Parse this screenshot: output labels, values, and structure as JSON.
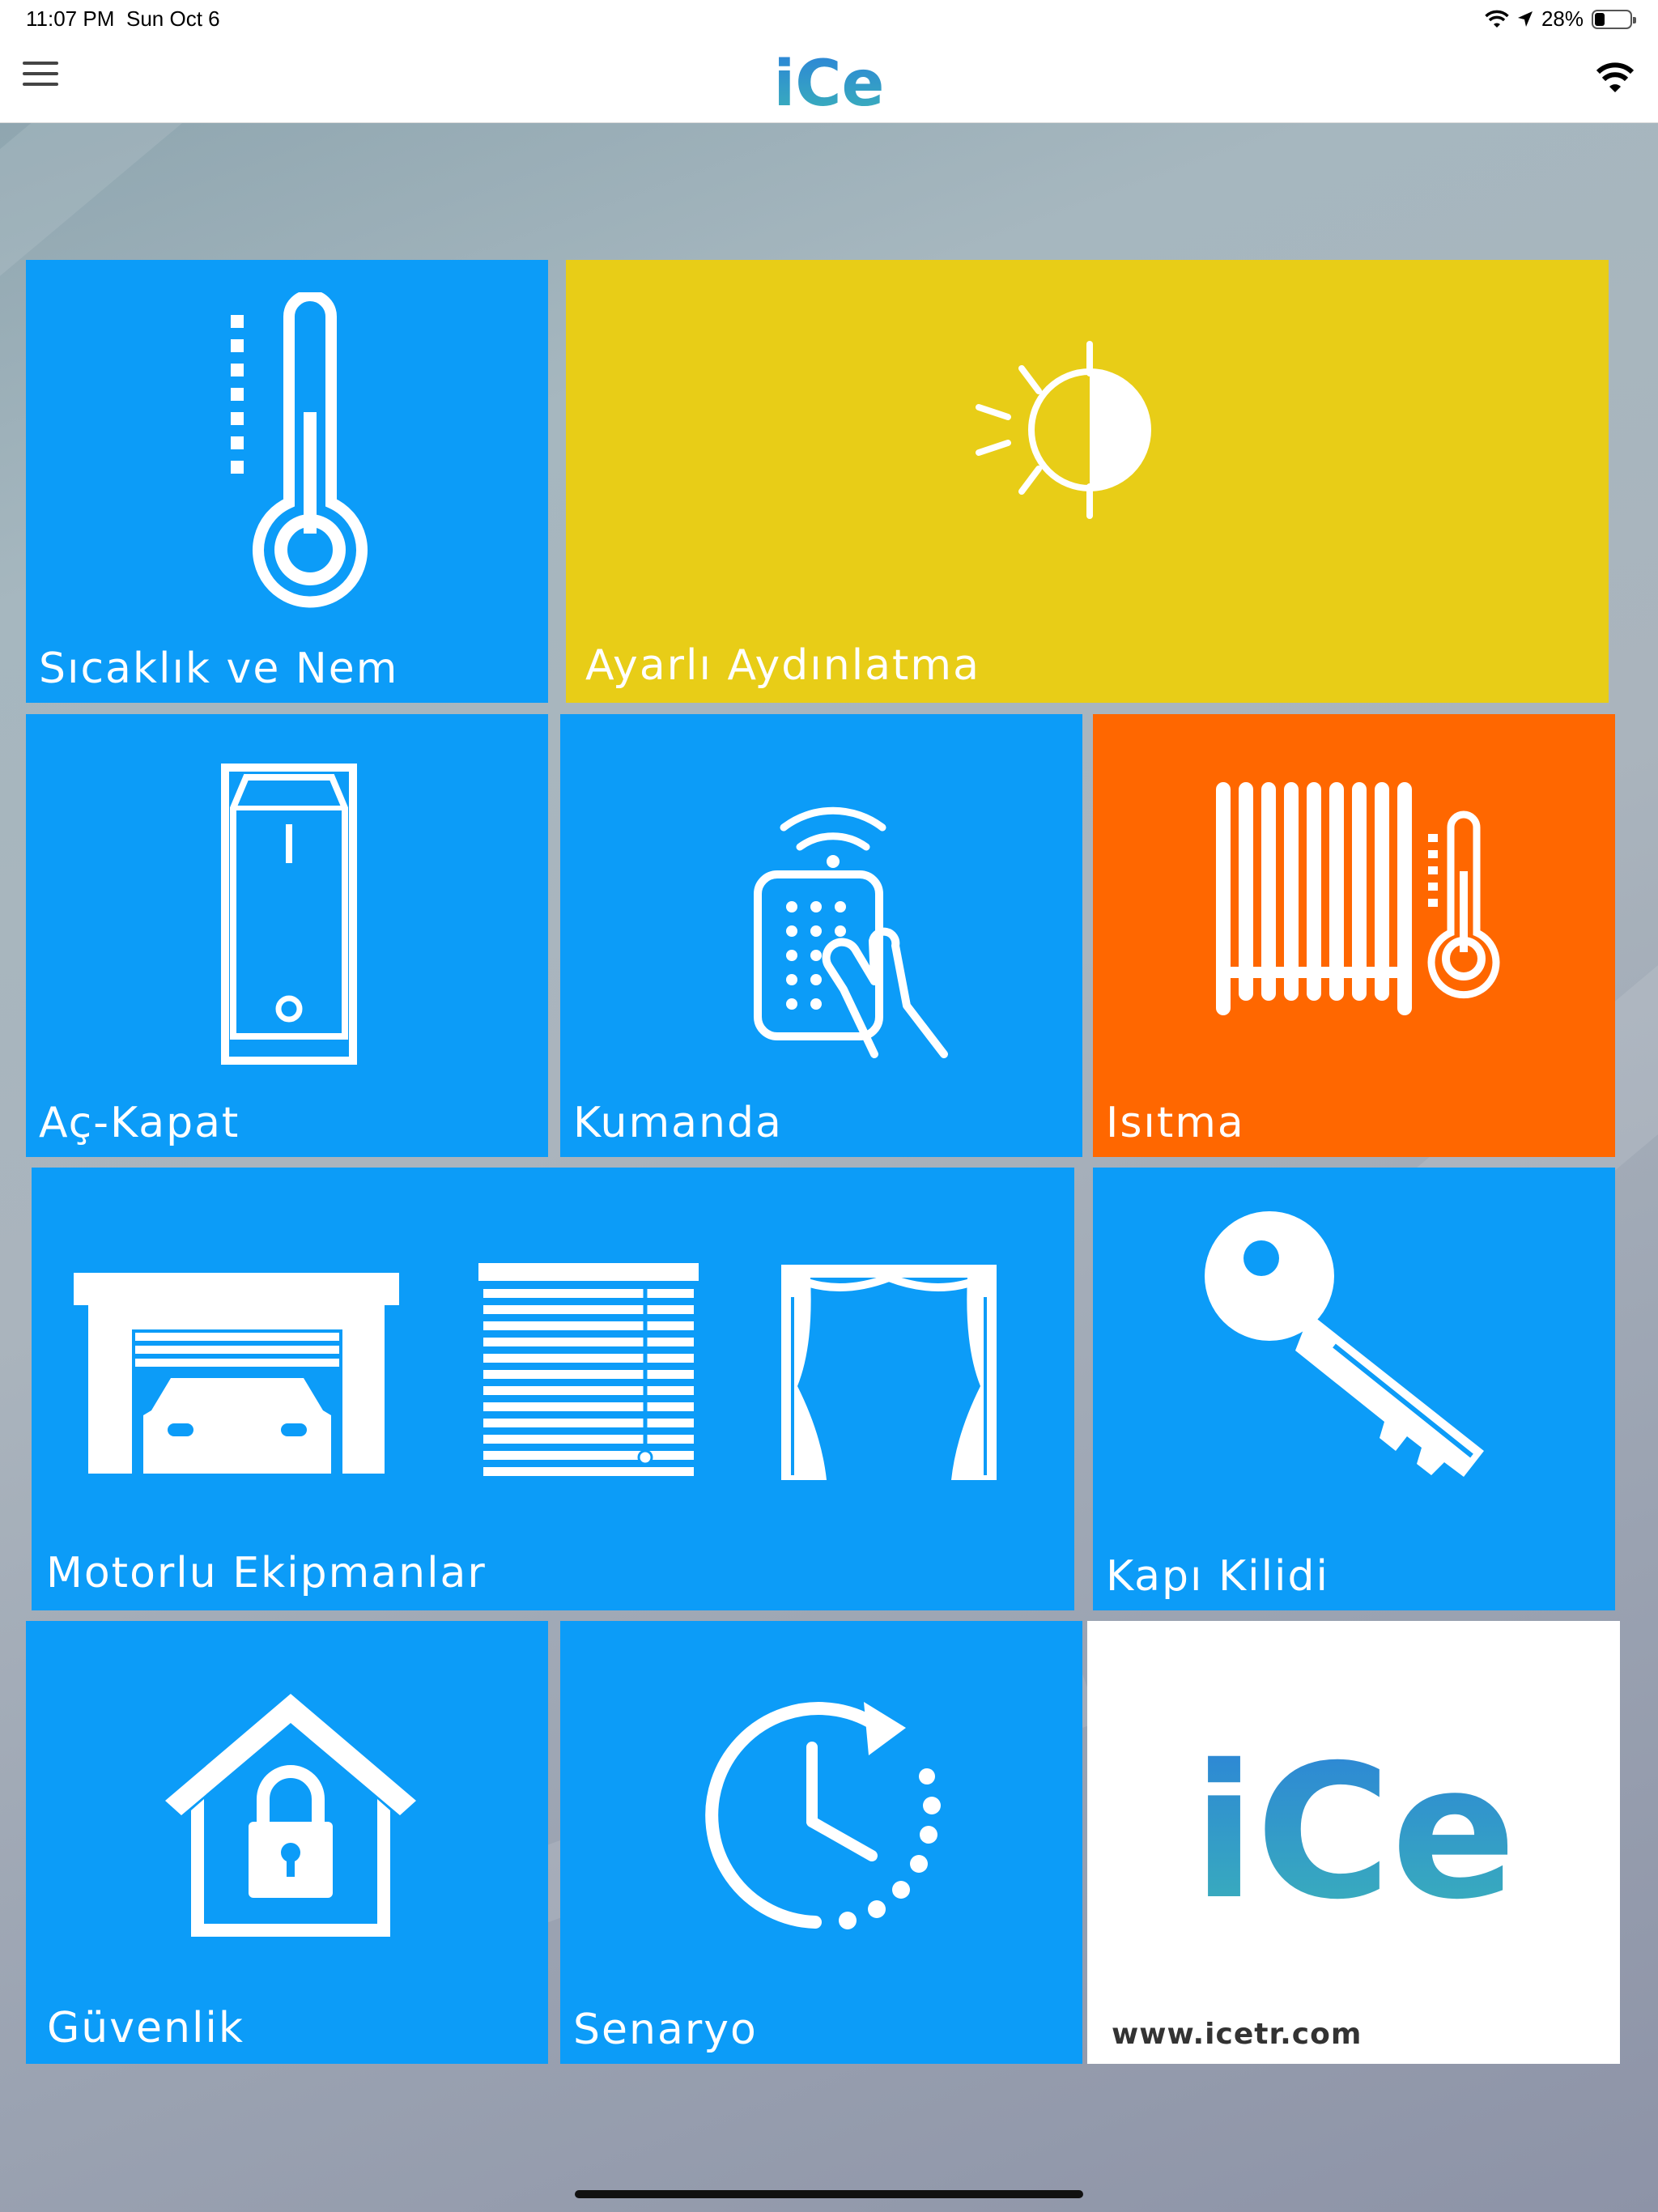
{
  "status_bar": {
    "time": "11:07 PM",
    "date": "Sun Oct 6",
    "battery_text": "28%",
    "battery_level": 0.28
  },
  "nav": {
    "logo_text": "iCe",
    "menu_icon": "hamburger-menu-icon",
    "connection_icon": "wifi-icon"
  },
  "colors": {
    "tile_blue": "#0c9cf8",
    "tile_yellow": "#e8cd17",
    "tile_orange": "#ff6700",
    "logo_blue": "#2b82d9",
    "logo_teal": "#3bb3b8"
  },
  "tiles": [
    {
      "label": "Sıcaklık ve Nem",
      "icon": "thermometer-icon"
    },
    {
      "label": "Ayarlı Aydınlatma",
      "icon": "dimmer-sun-icon"
    },
    {
      "label": "Aç-Kapat",
      "icon": "rocker-switch-icon"
    },
    {
      "label": "Kumanda",
      "icon": "remote-control-icon"
    },
    {
      "label": "Isıtma",
      "icon": "radiator-icon"
    },
    {
      "label": "Motorlu Ekipmanlar",
      "icon": "garage-blinds-curtain-icon"
    },
    {
      "label": "Kapı Kilidi",
      "icon": "key-icon"
    },
    {
      "label": "Güvenlik",
      "icon": "house-lock-icon"
    },
    {
      "label": "Senaryo",
      "icon": "clock-cycle-icon"
    }
  ],
  "brand_tile": {
    "logo_text": "iCe",
    "url": "www.icetr.com"
  }
}
